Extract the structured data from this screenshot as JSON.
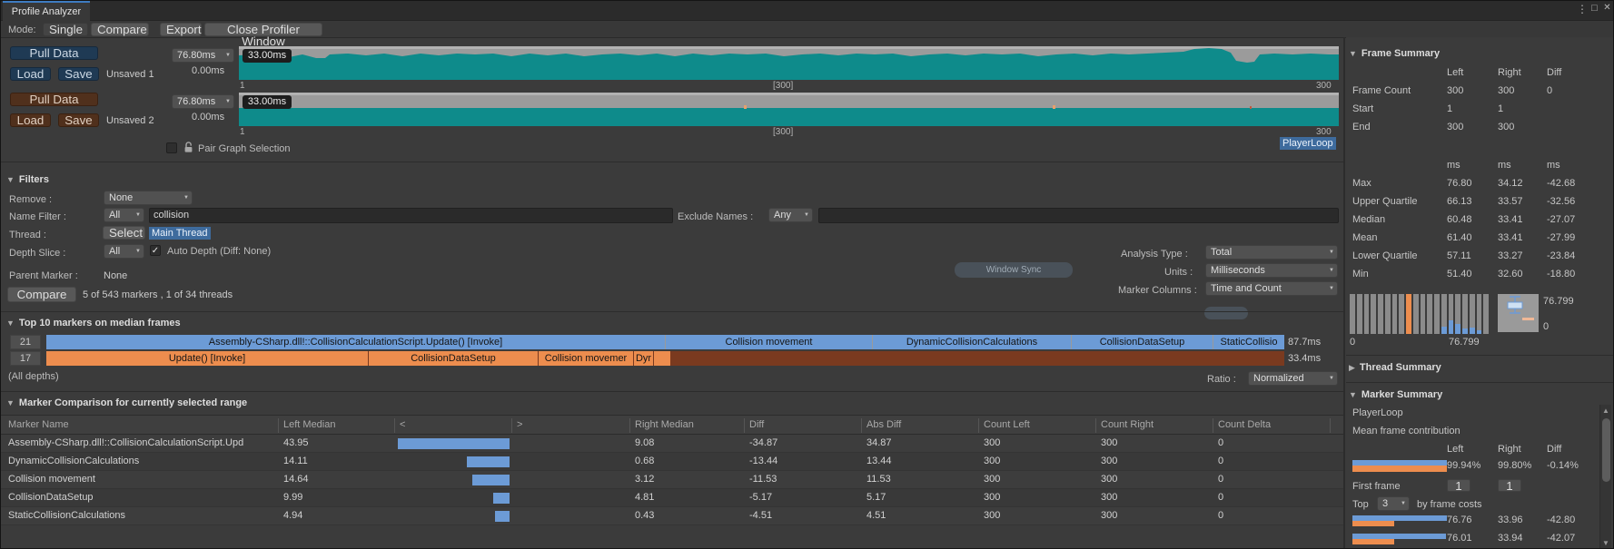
{
  "icons": {
    "menu": "⋮",
    "maximize": "□",
    "close": "✕",
    "foldout_open": "▼",
    "foldout_closed": "▶",
    "dropdown_arrow": "▼",
    "check": "✓",
    "scroll_up": "▲",
    "scroll_down": "▼"
  },
  "tab": {
    "title": "Profile Analyzer"
  },
  "toolbar": {
    "mode_label": "Mode:",
    "single": "Single",
    "compare": "Compare",
    "export": "Export",
    "close_profiler": "Close Profiler Window"
  },
  "datasets": {
    "left": {
      "pull": "Pull Data",
      "load": "Load",
      "save": "Save",
      "name": "Unsaved 1",
      "range_max": "76.80ms",
      "range_min": "0.00ms",
      "threshold": "33.00ms",
      "axis_start": "1",
      "axis_mid": "[300]",
      "axis_end": "300"
    },
    "right": {
      "pull": "Pull Data",
      "load": "Load",
      "save": "Save",
      "name": "Unsaved 2",
      "range_max": "76.80ms",
      "range_min": "0.00ms",
      "threshold": "33.00ms",
      "axis_start": "1",
      "axis_mid": "[300]",
      "axis_end": "300"
    },
    "pair_graph_label": "Pair Graph Selection",
    "selected_marker": "PlayerLoop"
  },
  "filters": {
    "title": "Filters",
    "remove_label": "Remove :",
    "remove_value": "None",
    "name_filter_label": "Name Filter :",
    "name_filter_mode": "All",
    "name_filter_value": "collision",
    "exclude_label": "Exclude Names :",
    "exclude_mode": "Any",
    "exclude_value": "",
    "thread_label": "Thread :",
    "thread_select": "Select",
    "thread_value": "Main Thread",
    "depth_label": "Depth Slice :",
    "depth_mode": "All",
    "auto_depth_label": "Auto Depth (Diff: None)",
    "parent_label": "Parent Marker :",
    "parent_value": "None",
    "analysis_label": "Analysis Type :",
    "analysis_value": "Total",
    "units_label": "Units :",
    "units_value": "Milliseconds",
    "marker_columns_label": "Marker Columns :",
    "marker_columns_value": "Time and Count",
    "compare_button": "Compare",
    "status": "5 of 543 markers , 1 of 34 threads",
    "ghost_label": "Window Sync"
  },
  "top10": {
    "title": "Top 10 markers on median frames",
    "row_left": {
      "depth": "21",
      "value": "87.7ms",
      "segments": [
        "Assembly-CSharp.dll!::CollisionCalculationScript.Update() [Invoke]",
        "Collision movement",
        "DynamicCollisionCalculations",
        "CollisionDataSetup",
        "StaticCollisio"
      ]
    },
    "row_right": {
      "depth": "17",
      "value": "33.4ms",
      "segments": [
        "Update() [Invoke]",
        "CollisionDataSetup",
        "Collision movemer",
        "Dyr",
        ""
      ]
    },
    "all_depths": "(All depths)",
    "ratio_label": "Ratio :",
    "ratio_value": "Normalized"
  },
  "comparison": {
    "title": "Marker Comparison for currently selected range",
    "columns": [
      "Marker Name",
      "Left Median",
      "<",
      ">",
      "Right Median",
      "Diff",
      "Abs Diff",
      "Count Left",
      "Count Right",
      "Count Delta"
    ],
    "rows": [
      {
        "name": "Assembly-CSharp.dll!::CollisionCalculationScript.Upd",
        "left_median": "43.95",
        "bar": 123,
        "right_median": "9.08",
        "diff": "-34.87",
        "abs_diff": "34.87",
        "count_left": "300",
        "count_right": "300",
        "count_delta": "0"
      },
      {
        "name": "DynamicCollisionCalculations",
        "left_median": "14.11",
        "bar": 47,
        "right_median": "0.68",
        "diff": "-13.44",
        "abs_diff": "13.44",
        "count_left": "300",
        "count_right": "300",
        "count_delta": "0"
      },
      {
        "name": "Collision movement",
        "left_median": "14.64",
        "bar": 41,
        "right_median": "3.12",
        "diff": "-11.53",
        "abs_diff": "11.53",
        "count_left": "300",
        "count_right": "300",
        "count_delta": "0"
      },
      {
        "name": "CollisionDataSetup",
        "left_median": "9.99",
        "bar": 18,
        "right_median": "4.81",
        "diff": "-5.17",
        "abs_diff": "5.17",
        "count_left": "300",
        "count_right": "300",
        "count_delta": "0"
      },
      {
        "name": "StaticCollisionCalculations",
        "left_median": "4.94",
        "bar": 16,
        "right_median": "0.43",
        "diff": "-4.51",
        "abs_diff": "4.51",
        "count_left": "300",
        "count_right": "300",
        "count_delta": "0"
      }
    ]
  },
  "frame_summary": {
    "title": "Frame Summary",
    "columns": [
      "Left",
      "Right",
      "Diff"
    ],
    "info_rows": [
      {
        "label": "Frame Count",
        "left": "300",
        "right": "300",
        "diff": "0"
      },
      {
        "label": "Start",
        "left": "1",
        "right": "1",
        "diff": ""
      },
      {
        "label": "End",
        "left": "300",
        "right": "300",
        "diff": ""
      }
    ],
    "unit_row": {
      "left": "ms",
      "right": "ms",
      "diff": "ms"
    },
    "stat_rows": [
      {
        "label": "Max",
        "left": "76.80",
        "right": "34.12",
        "diff": "-42.68"
      },
      {
        "label": "Upper Quartile",
        "left": "66.13",
        "right": "33.57",
        "diff": "-32.56"
      },
      {
        "label": "Median",
        "left": "60.48",
        "right": "33.41",
        "diff": "-27.07"
      },
      {
        "label": "Mean",
        "left": "61.40",
        "right": "33.41",
        "diff": "-27.99"
      },
      {
        "label": "Lower Quartile",
        "left": "57.11",
        "right": "33.27",
        "diff": "-23.84"
      },
      {
        "label": "Min",
        "left": "51.40",
        "right": "32.60",
        "diff": "-18.80"
      }
    ],
    "histogram": {
      "axis_min": "0",
      "axis_max": "76.799",
      "bar_count": 20,
      "orange_index": 8,
      "blue_bars": {
        "13": 18,
        "14": 34,
        "15": 25,
        "16": 14,
        "17": 16,
        "18": 10
      }
    },
    "boxplot": {
      "max": "76.799",
      "min": "0"
    }
  },
  "thread_summary": {
    "title": "Thread Summary"
  },
  "marker_summary": {
    "title": "Marker Summary",
    "marker_name": "PlayerLoop",
    "subtitle": "Mean frame contribution",
    "columns": [
      "Left",
      "Right",
      "Diff"
    ],
    "contribution": {
      "left": "99.94%",
      "right": "99.80%",
      "diff": "-0.14%"
    },
    "first_frame_label": "First frame",
    "first_frame_left": "1",
    "first_frame_right": "1",
    "top_label": "Top",
    "top_count": "3",
    "top_suffix": "by frame costs",
    "cost_rows": [
      {
        "left": "76.76",
        "right": "33.96",
        "diff": "-42.80",
        "lw": 104,
        "rw": 46
      },
      {
        "left": "76.01",
        "right": "33.94",
        "diff": "-42.07",
        "lw": 103,
        "rw": 46
      }
    ]
  }
}
